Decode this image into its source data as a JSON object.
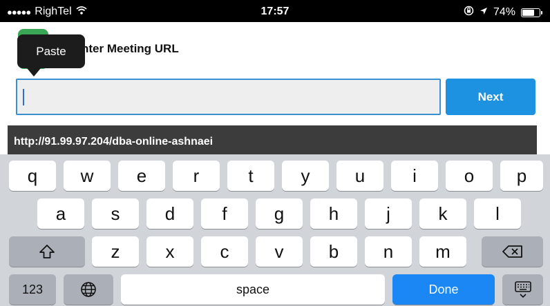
{
  "status_bar": {
    "carrier": "RighTel",
    "signal_dots": "●●●●●",
    "time": "17:57",
    "battery_percent": "74%",
    "battery_level": 0.74,
    "icons": [
      "wifi-icon",
      "rotation-lock-icon",
      "location-arrow-icon",
      "battery-icon"
    ]
  },
  "app": {
    "title": "nter Meeting URL",
    "tooltip": "Paste",
    "url_input": {
      "value": "",
      "placeholder": ""
    },
    "next_label": "Next",
    "suggestion": "http://91.99.97.204/dba-online-ashnaei",
    "colors": {
      "accent": "#1d92e0",
      "input_border": "#3a8fd0",
      "icon_green": "#3aa757"
    }
  },
  "keyboard": {
    "row1": [
      "q",
      "w",
      "e",
      "r",
      "t",
      "y",
      "u",
      "i",
      "o",
      "p"
    ],
    "row2": [
      "a",
      "s",
      "d",
      "f",
      "g",
      "h",
      "j",
      "k",
      "l"
    ],
    "row3": [
      "z",
      "x",
      "c",
      "v",
      "b",
      "n",
      "m"
    ],
    "numbers_label": "123",
    "space_label": "space",
    "done_label": "Done",
    "icons": [
      "shift-icon",
      "backspace-icon",
      "globe-icon",
      "keyboard-dismiss-icon"
    ]
  }
}
